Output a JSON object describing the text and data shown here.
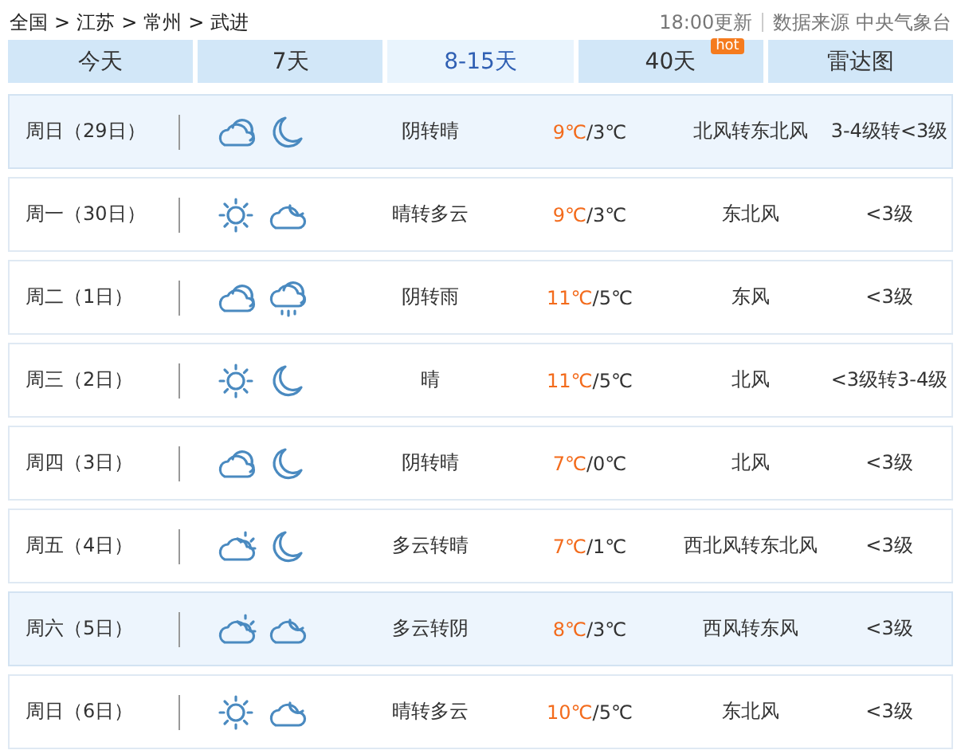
{
  "breadcrumb": [
    "全国",
    "江苏",
    "常州",
    "武进"
  ],
  "breadcrumb_separator": ">",
  "temp_separator": "/",
  "update_time": "18:00更新",
  "source": "数据来源 中央气象台",
  "tabs": [
    {
      "label": "今天",
      "selected": false
    },
    {
      "label": "7天",
      "selected": false
    },
    {
      "label": "8-15天",
      "selected": true
    },
    {
      "label": "40天",
      "selected": false,
      "badge": "hot"
    },
    {
      "label": "雷达图",
      "selected": false
    }
  ],
  "days": [
    {
      "day": "周日（29日）",
      "highlighted": true,
      "icons": [
        {
          "kind": "cloud"
        },
        {
          "kind": "moon"
        }
      ],
      "weather": "阴转晴",
      "high": "9℃",
      "low": "3℃",
      "wind": "北风转东北风",
      "level": "3-4级转<3级"
    },
    {
      "day": "周一（30日）",
      "highlighted": false,
      "icons": [
        {
          "kind": "sun"
        },
        {
          "kind": "cloud-moon"
        }
      ],
      "weather": "晴转多云",
      "high": "9℃",
      "low": "3℃",
      "wind": "东北风",
      "level": "<3级"
    },
    {
      "day": "周二（1日）",
      "highlighted": false,
      "icons": [
        {
          "kind": "cloud"
        },
        {
          "kind": "rain"
        }
      ],
      "weather": "阴转雨",
      "high": "11℃",
      "low": "5℃",
      "wind": "东风",
      "level": "<3级"
    },
    {
      "day": "周三（2日）",
      "highlighted": false,
      "icons": [
        {
          "kind": "sun"
        },
        {
          "kind": "moon"
        }
      ],
      "weather": "晴",
      "high": "11℃",
      "low": "5℃",
      "wind": "北风",
      "level": "<3级转3-4级"
    },
    {
      "day": "周四（3日）",
      "highlighted": false,
      "icons": [
        {
          "kind": "cloud"
        },
        {
          "kind": "moon"
        }
      ],
      "weather": "阴转晴",
      "high": "7℃",
      "low": "0℃",
      "wind": "北风",
      "level": "<3级"
    },
    {
      "day": "周五（4日）",
      "highlighted": false,
      "icons": [
        {
          "kind": "cloud-sun"
        },
        {
          "kind": "moon"
        }
      ],
      "weather": "多云转晴",
      "high": "7℃",
      "low": "1℃",
      "wind": "西北风转东北风",
      "level": "<3级"
    },
    {
      "day": "周六（5日）",
      "highlighted": true,
      "icons": [
        {
          "kind": "cloud-sun"
        },
        {
          "kind": "cloud-moon"
        }
      ],
      "weather": "多云转阴",
      "high": "8℃",
      "low": "3℃",
      "wind": "西风转东风",
      "level": "<3级"
    },
    {
      "day": "周日（6日）",
      "highlighted": false,
      "icons": [
        {
          "kind": "sun"
        },
        {
          "kind": "cloud-moon"
        }
      ],
      "weather": "晴转多云",
      "high": "10℃",
      "low": "5℃",
      "wind": "东北风",
      "level": "<3级"
    }
  ]
}
